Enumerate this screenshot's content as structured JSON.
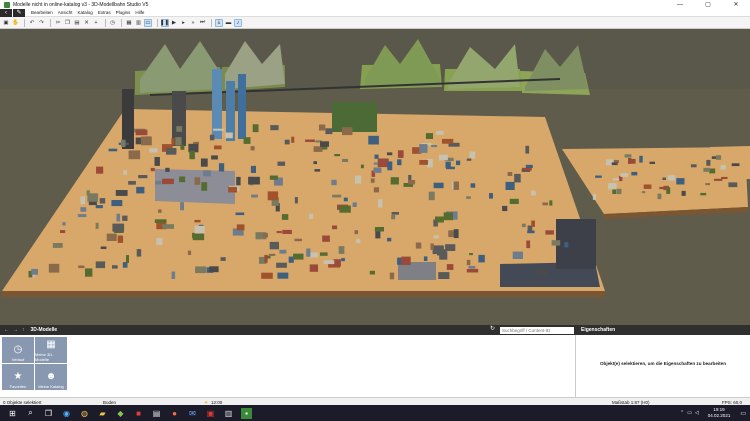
{
  "window": {
    "title": "Modelle nicht in online-katalog v3 - 3D-Modellbahn Studio V5"
  },
  "menu": [
    "Bearbeiten",
    "Ansicht",
    "Katalog",
    "Extras",
    "Plugins",
    "Hilfe"
  ],
  "toolbar_icons": [
    "save-icon",
    "pan-hand-icon",
    "undo-icon",
    "redo-icon",
    "cut-icon",
    "copy-icon",
    "paste-icon",
    "delete-icon",
    "zoom-in-icon",
    "clock-icon",
    "layout-icon",
    "grid-icon",
    "view-3d-icon",
    "pause-icon",
    "play-icon",
    "step-icon",
    "fast-forward-icon",
    "skip-icon",
    "sound-icon"
  ],
  "catalog": {
    "header_title": "3D-Modelle",
    "search_placeholder": "Suchbegriff / Content-ID",
    "tiles": [
      {
        "label": "Verlauf",
        "icon": "clock-icon"
      },
      {
        "label": "Meine 3D-Modelle",
        "icon": "grid-icon"
      },
      {
        "label": "Favoriten",
        "icon": "star-icon"
      },
      {
        "label": "Meine Katalog",
        "icon": "people-icon"
      }
    ]
  },
  "properties": {
    "header_title": "Eigenschaften",
    "hint": "Objekt(e) selektieren, um die Eigenschaften zu bearbeiten"
  },
  "status": {
    "selection": "0 Objekte selektiert",
    "surface": "Boden",
    "time": "12:00",
    "scale": "Maßstab 1:87 (H0)",
    "fps": "FPS: 60,0"
  },
  "taskbar": {
    "clock_time": "19:19",
    "clock_date": "04.02.2021"
  },
  "colors": {
    "panel_header": "#2f2f2f",
    "tile": "#8898b0",
    "taskbar": "#1b1b2a",
    "board": "#d8a86a"
  }
}
